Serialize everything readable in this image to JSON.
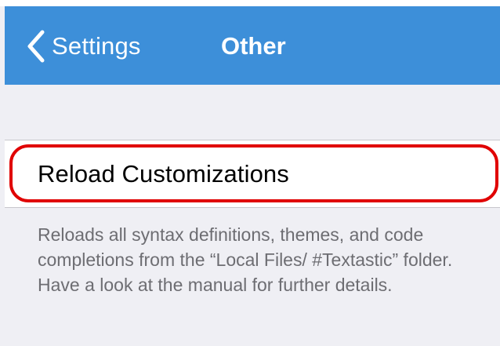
{
  "navbar": {
    "back_label": "Settings",
    "title": "Other",
    "background_color": "#3d8fd9",
    "back_icon": "chevron-left-icon"
  },
  "settings": {
    "reload_customizations_label": "Reload Customizations",
    "reload_customizations_description": "Reloads all syntax definitions, themes, and code completions from the “Local Files/ #Textastic” folder. Have a look at the manual for further details."
  },
  "highlight": {
    "color": "#e00000"
  }
}
